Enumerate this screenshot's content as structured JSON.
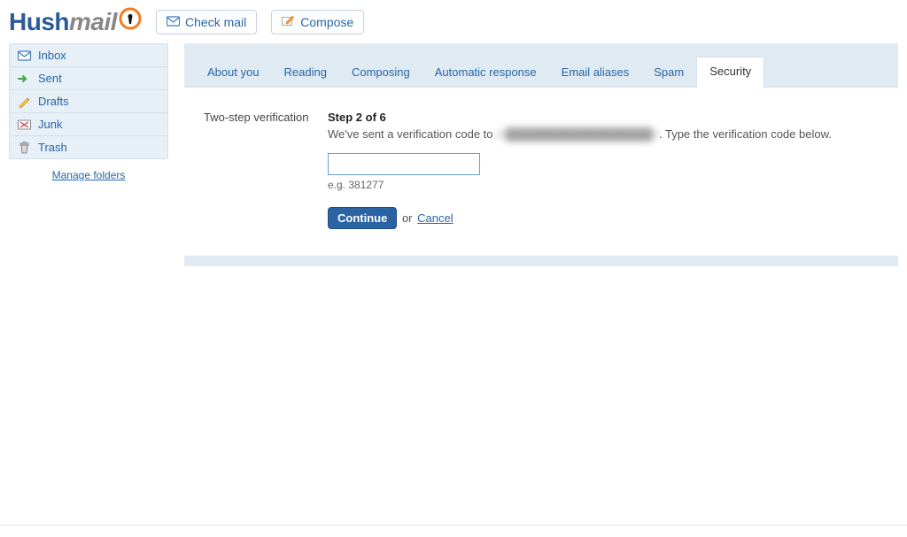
{
  "header": {
    "logo_hush": "Hush",
    "logo_mail": "mail",
    "check_mail": "Check mail",
    "compose": "Compose"
  },
  "sidebar": {
    "folders": [
      {
        "label": "Inbox",
        "icon": "inbox-icon"
      },
      {
        "label": "Sent",
        "icon": "sent-icon"
      },
      {
        "label": "Drafts",
        "icon": "drafts-icon"
      },
      {
        "label": "Junk",
        "icon": "junk-icon"
      },
      {
        "label": "Trash",
        "icon": "trash-icon"
      }
    ],
    "manage": "Manage folders"
  },
  "tabs": [
    {
      "label": "About you",
      "active": false
    },
    {
      "label": "Reading",
      "active": false
    },
    {
      "label": "Composing",
      "active": false
    },
    {
      "label": "Automatic response",
      "active": false
    },
    {
      "label": "Email aliases",
      "active": false
    },
    {
      "label": "Spam",
      "active": false
    },
    {
      "label": "Security",
      "active": true
    }
  ],
  "verify": {
    "section_label": "Two-step verification",
    "step_title": "Step 2 of 6",
    "instruction_prefix": "We've sent a verification code to ",
    "masked_address": "m██████████████████n",
    "instruction_suffix": ". Type the verification code below.",
    "hint": "e.g. 381277",
    "continue": "Continue",
    "or": "or",
    "cancel": "Cancel"
  }
}
